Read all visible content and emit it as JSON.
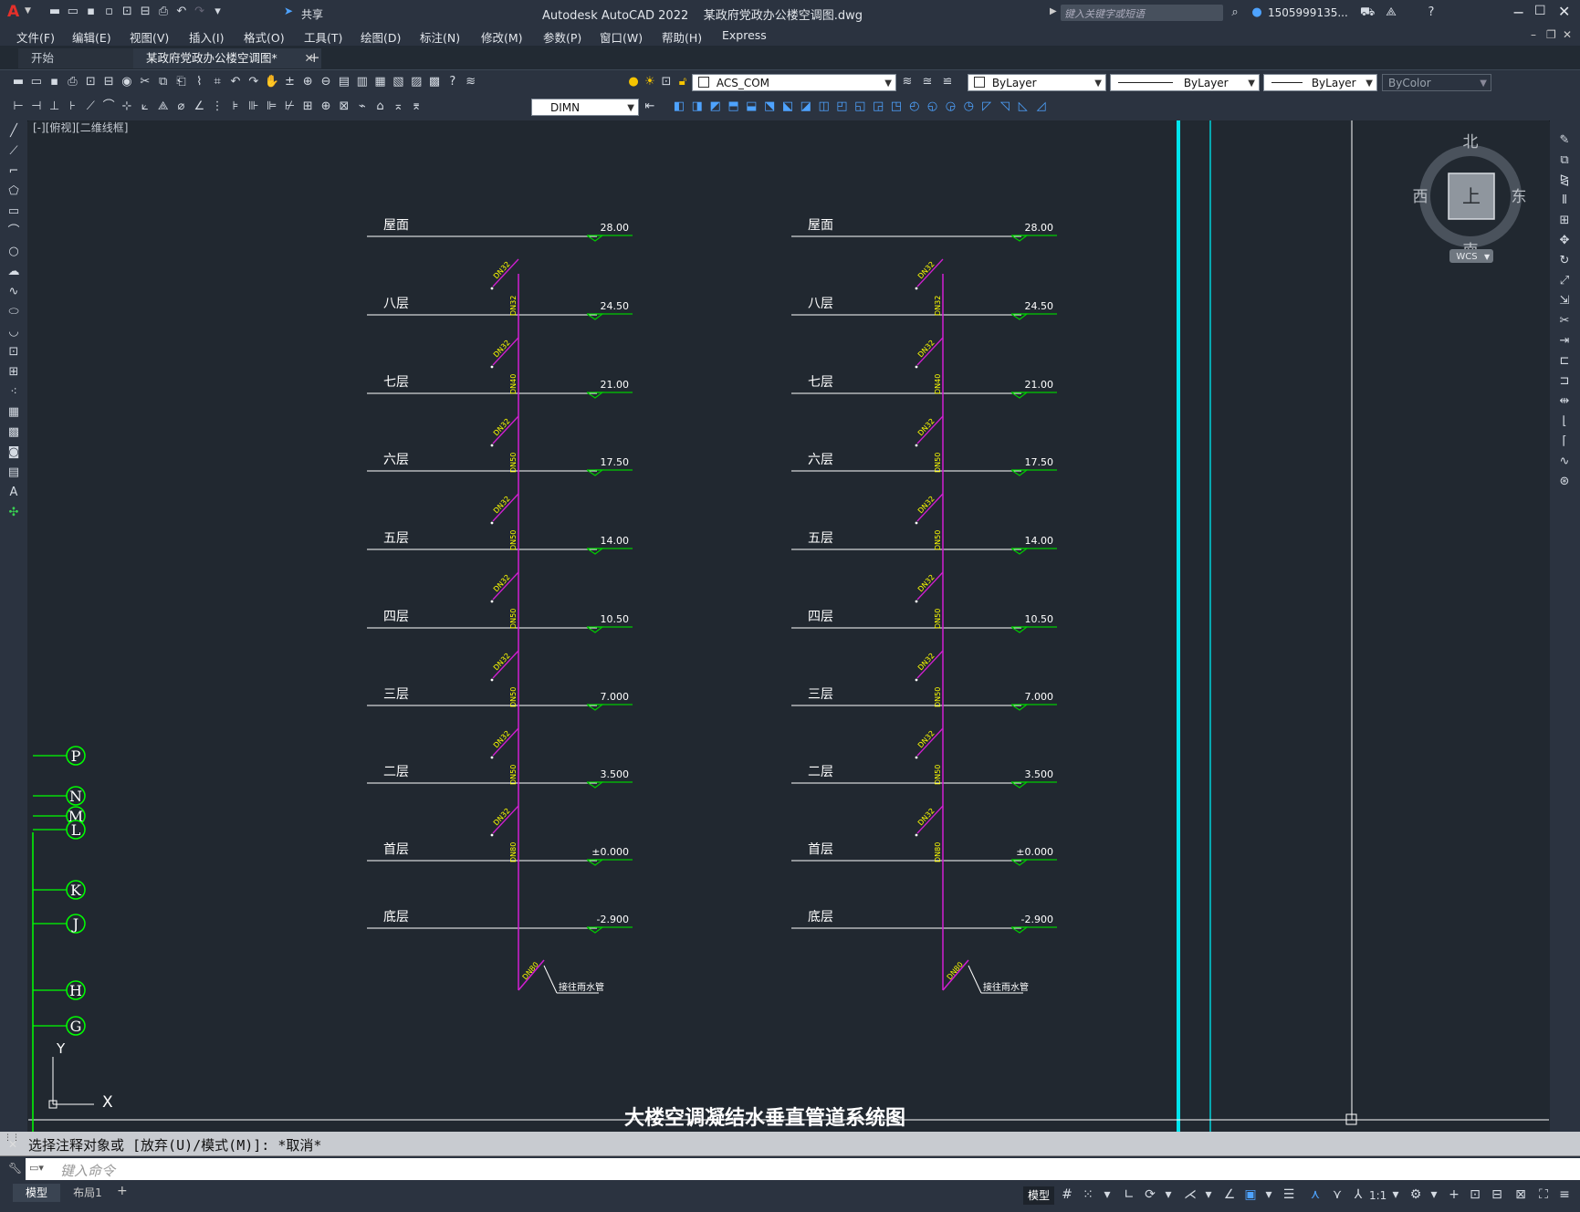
{
  "app": {
    "title": "Autodesk AutoCAD 2022    某政府党政办公楼空调图.dwg",
    "search_placeholder": "键入关键字或短语",
    "user": "1505999135...",
    "share_label": "共享"
  },
  "menu": [
    "文件(F)",
    "编辑(E)",
    "视图(V)",
    "插入(I)",
    "格式(O)",
    "工具(T)",
    "绘图(D)",
    "标注(N)",
    "修改(M)",
    "参数(P)",
    "窗口(W)",
    "帮助(H)",
    "Express"
  ],
  "tabs": [
    {
      "label": "开始"
    },
    {
      "label": "某政府党政办公楼空调图*"
    }
  ],
  "toolbar": {
    "layer_name": "ACS_COM",
    "color": "ByLayer",
    "linetype": "ByLayer",
    "lineweight": "ByLayer",
    "plotstyle": "ByColor",
    "dimstyle": "DIMN"
  },
  "viewport_label": "[-][俯视][二维线框]",
  "viewcube": {
    "north": "北",
    "south": "南",
    "east": "东",
    "west": "西",
    "face": "上",
    "wcs": "WCS"
  },
  "drawing": {
    "title": "大楼空调凝结水垂直管道系统图",
    "floors": [
      {
        "name": "屋面",
        "elev": "28.00"
      },
      {
        "name": "八层",
        "elev": "24.50"
      },
      {
        "name": "七层",
        "elev": "21.00"
      },
      {
        "name": "六层",
        "elev": "17.50"
      },
      {
        "name": "五层",
        "elev": "14.00"
      },
      {
        "name": "四层",
        "elev": "10.50"
      },
      {
        "name": "三层",
        "elev": "7.000"
      },
      {
        "name": "二层",
        "elev": "3.500"
      },
      {
        "name": "首层",
        "elev": "±0.000"
      },
      {
        "name": "底层",
        "elev": "-2.900"
      }
    ],
    "riser_labels": [
      "DN32",
      "DN40",
      "DN50",
      "DN50",
      "DN50",
      "DN50",
      "DN50",
      "DN80"
    ],
    "branch_label": "DN32",
    "bottom_label": "DN80",
    "outlet_note": "接往雨水管",
    "grid_bubbles": [
      "P",
      "N",
      "M",
      "L",
      "K",
      "J",
      "H",
      "G"
    ],
    "ucs": {
      "x": "X",
      "y": "Y"
    }
  },
  "command": {
    "history": "选择注释对象或 [放弃(U)/模式(M)]: *取消*",
    "placeholder": "键入命令"
  },
  "status": {
    "layout_tabs": [
      "模型",
      "布局1"
    ],
    "model_label": "模型",
    "scale": "1:1"
  },
  "colors": {
    "riser": "#d21fd2",
    "dim_text": "#ffff00",
    "elev_marker": "#00cc00",
    "cyan_line": "#00e5ee"
  }
}
